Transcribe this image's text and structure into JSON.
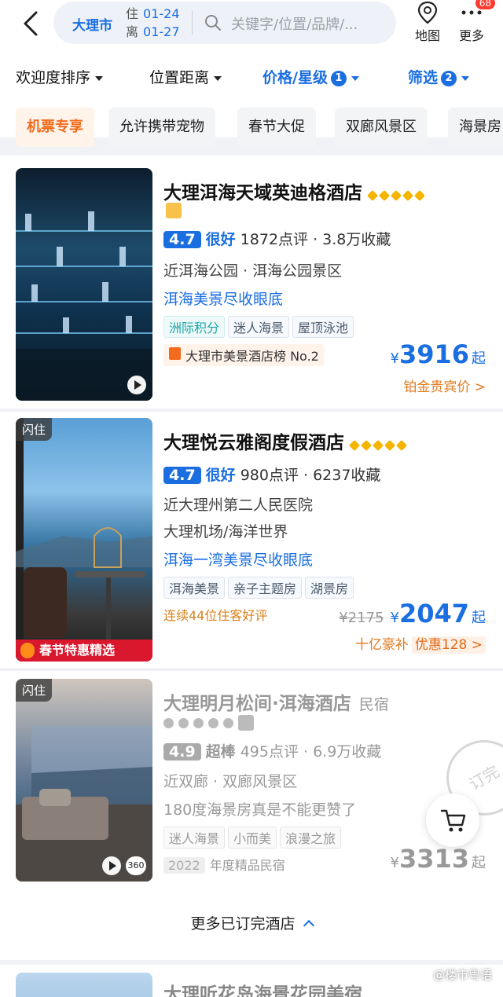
{
  "header": {
    "city": "大理市",
    "checkin_label": "住",
    "checkin_date": "01-24",
    "checkout_label": "离",
    "checkout_date": "01-27",
    "search_placeholder": "关键字/位置/品牌/...",
    "map_label": "地图",
    "more_label": "更多",
    "more_badge": "68"
  },
  "sort_bar": [
    {
      "label": "欢迎度排序"
    },
    {
      "label": "位置距离"
    },
    {
      "label": "价格/星级",
      "count": "1"
    },
    {
      "label": "筛选",
      "count": "2"
    }
  ],
  "quick_tags": [
    "机票专享",
    "允许携带宠物",
    "春节大促",
    "双廊风景区",
    "海景房"
  ],
  "hotels": [
    {
      "name": "大理洱海天域英迪格酒店",
      "score": "4.7",
      "score_word": "很好",
      "reviews": "1872点评 · 3.8万收藏",
      "location": "近洱海公园 · 洱海公园景区",
      "slogan": "洱海美景尽收眼底",
      "chips": [
        "洲际积分",
        "迷人海景",
        "屋顶泳池"
      ],
      "rank": "大理市美景酒店榜 No.2",
      "price": "3916",
      "price_suffix": "起",
      "price_note": "铂金贵宾价 >"
    },
    {
      "flash": "闪住",
      "promo": "春节特惠精选",
      "name": "大理悦云雅阁度假酒店",
      "score": "4.7",
      "score_word": "很好",
      "reviews": "980点评 · 6237收藏",
      "location": "近大理州第二人民医院",
      "location2": "大理机场/海洋世界",
      "slogan": "洱海一湾美景尽收眼底",
      "chips": [
        "洱海美景",
        "亲子主题房",
        "湖景房"
      ],
      "streak": "连续44位住客好评",
      "old_price": "¥2175",
      "price": "2047",
      "price_suffix": "起",
      "subsidy": "十亿豪补",
      "discount": "优惠128 >"
    },
    {
      "flash": "闪住",
      "name": "大理明月松间·洱海酒店",
      "type": "民宿",
      "score": "4.9",
      "score_word": "超棒",
      "reviews": "495点评 · 6.9万收藏",
      "location": "近双廊 · 双廊风景区",
      "slogan": "180度海景房真是不能更赞了",
      "chips": [
        "迷人海景",
        "小而美",
        "浪漫之旅"
      ],
      "award_year": "2022",
      "award": "年度精品民宿",
      "price": "3313",
      "price_suffix": "起",
      "stamp": "订完",
      "video_badge": "360"
    }
  ],
  "more_booked": "更多已订完酒店",
  "next_hotel_name": "大理听花岛海景花园美宿",
  "watermark": "@楼市粤语"
}
